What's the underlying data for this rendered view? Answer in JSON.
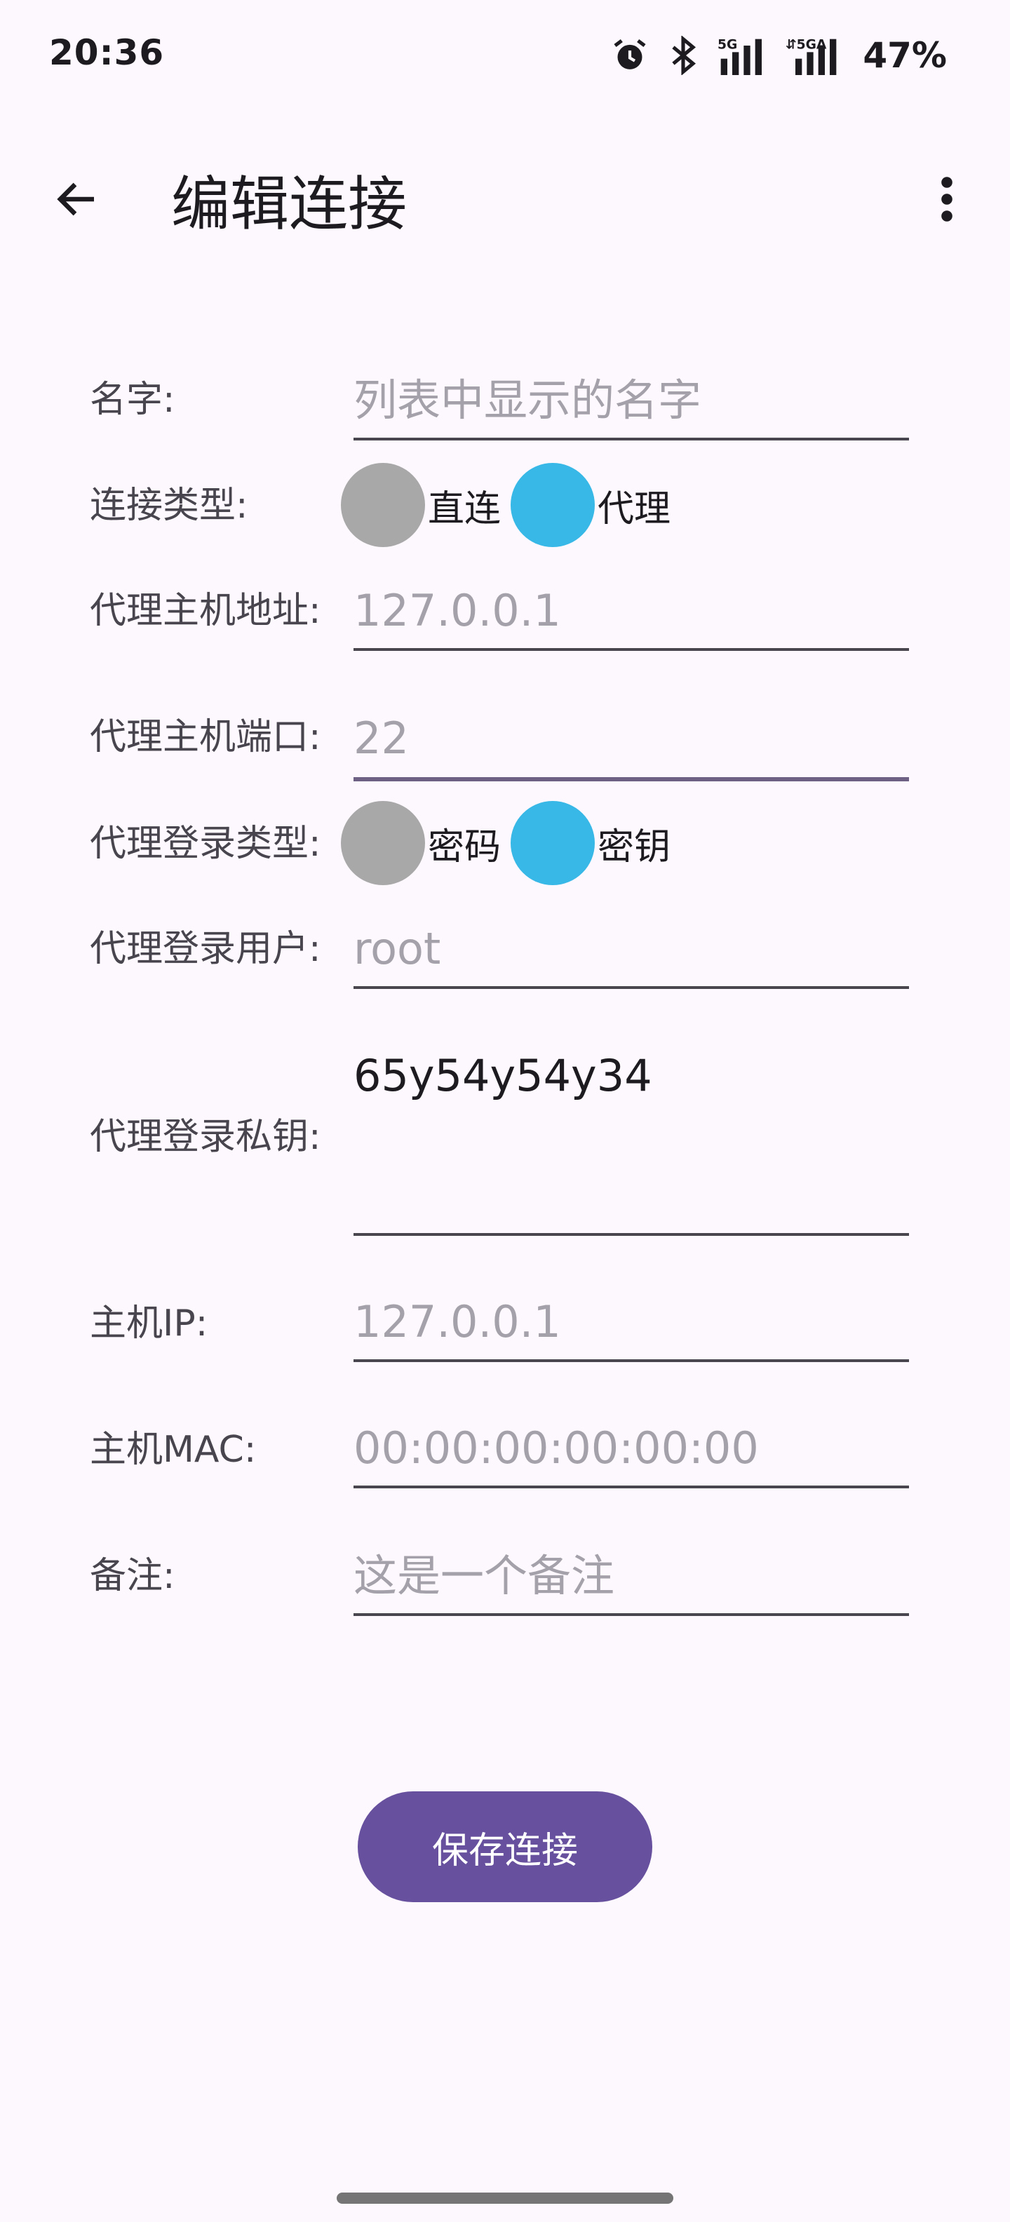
{
  "status_bar": {
    "time": "20:36",
    "battery": "47%",
    "icons": [
      "alarm-icon",
      "bluetooth-icon",
      "signal-5g-icon",
      "signal-5ga-icon"
    ]
  },
  "app_bar": {
    "title": "编辑连接",
    "icons": [
      "arrow-back-icon",
      "more-vert-icon"
    ]
  },
  "form": {
    "name": {
      "label": "名字:",
      "placeholder": "列表中显示的名字",
      "value": ""
    },
    "connection_type": {
      "label": "连接类型:",
      "options": [
        {
          "label": "直连",
          "state": "off"
        },
        {
          "label": "代理",
          "state": "on"
        }
      ]
    },
    "proxy_host": {
      "label": "代理主机地址:",
      "placeholder": "127.0.0.1",
      "value": ""
    },
    "proxy_port": {
      "label": "代理主机端口:",
      "placeholder": "22",
      "value": ""
    },
    "proxy_login_type": {
      "label": "代理登录类型:",
      "options": [
        {
          "label": "密码",
          "state": "off"
        },
        {
          "label": "密钥",
          "state": "on"
        }
      ]
    },
    "proxy_user": {
      "label": "代理登录用户:",
      "placeholder": "root",
      "value": ""
    },
    "proxy_key": {
      "label": "代理登录私钥:",
      "placeholder": "65y54y54y34",
      "value": ""
    },
    "host_ip": {
      "label": "主机IP:",
      "placeholder": "127.0.0.1",
      "value": ""
    },
    "host_mac": {
      "label": "主机MAC:",
      "placeholder": "00:00:00:00:00:00",
      "value": ""
    },
    "note": {
      "label": "备注:",
      "placeholder": "这是一个备注",
      "value": ""
    }
  },
  "save_button": {
    "label": "保存连接"
  },
  "colors": {
    "background": "#fdf7fe",
    "primary": "#67509d",
    "radio_on": "#37b8e6",
    "radio_off": "#a8a8a8"
  }
}
